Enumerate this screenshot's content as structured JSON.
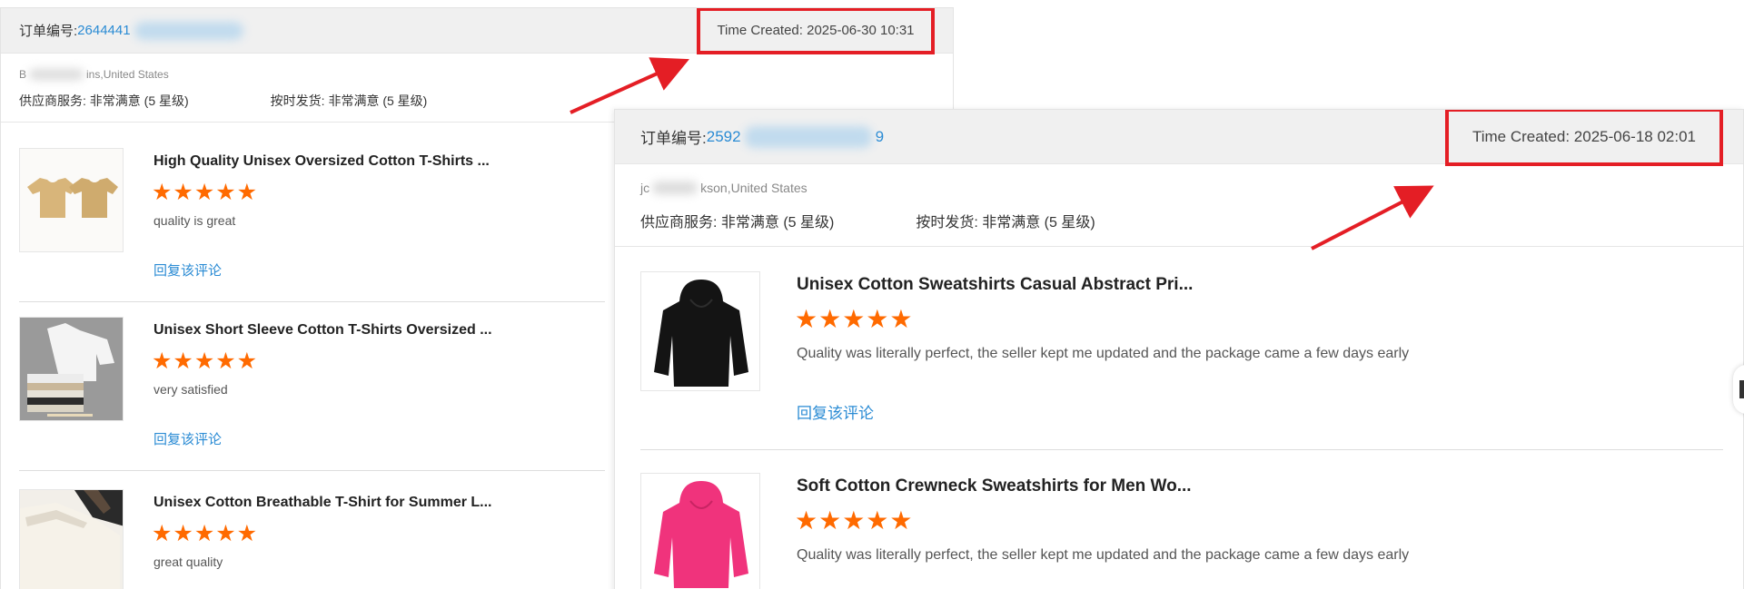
{
  "orders": [
    {
      "order_label": "订单编号:",
      "order_value": "2644441",
      "time_created": "Time Created: 2025-06-30 10:31",
      "buyer_prefix": "B",
      "buyer_suffix": "ins,United States",
      "ratings": {
        "supplier_service": "供应商服务: 非常满意  (5 星级)",
        "on_time_delivery": "按时发货: 非常满意  (5 星级)"
      },
      "items": [
        {
          "title": "High Quality Unisex Oversized Cotton T-Shirts ...",
          "stars": "★★★★★",
          "rating": 5,
          "comment": "quality is great",
          "reply": "回复该评论",
          "thumb_icon": "tan-tshirts-thumbnail"
        },
        {
          "title": "Unisex Short Sleeve Cotton T-Shirts Oversized ...",
          "stars": "★★★★★",
          "rating": 5,
          "comment": "very satisfied",
          "reply": "回复该评论",
          "thumb_icon": "folded-tshirts-thumbnail"
        },
        {
          "title": "Unisex Cotton Breathable T-Shirt for Summer L...",
          "stars": "★★★★★",
          "rating": 5,
          "comment": "great quality",
          "reply": "",
          "thumb_icon": "hanging-tshirts-thumbnail"
        }
      ]
    },
    {
      "order_label": "订单编号:",
      "order_value": "2592",
      "order_value_tail": "9",
      "time_created": "Time Created: 2025-06-18 02:01",
      "buyer_prefix": "jc",
      "buyer_suffix": "kson,United States",
      "ratings": {
        "supplier_service": "供应商服务: 非常满意  (5 星级)",
        "on_time_delivery": "按时发货: 非常满意  (5 星级)"
      },
      "items": [
        {
          "title": "Unisex Cotton Sweatshirts Casual Abstract Pri...",
          "stars": "★★★★★",
          "rating": 5,
          "comment": "Quality was literally perfect, the seller kept me updated and the package came a few days early",
          "reply": "回复该评论",
          "thumb_icon": "black-hoodie-thumbnail"
        },
        {
          "title": "Soft Cotton Crewneck Sweatshirts for Men Wo...",
          "stars": "★★★★★",
          "rating": 5,
          "comment": "Quality was literally perfect, the seller kept me updated and the package came a few days early",
          "reply": "",
          "thumb_icon": "pink-hoodie-thumbnail"
        }
      ]
    }
  ],
  "colors": {
    "highlight": "#e41e25",
    "star": "#ff6a00",
    "link": "#2a8bd4",
    "header_bg": "#f0f0f0"
  }
}
